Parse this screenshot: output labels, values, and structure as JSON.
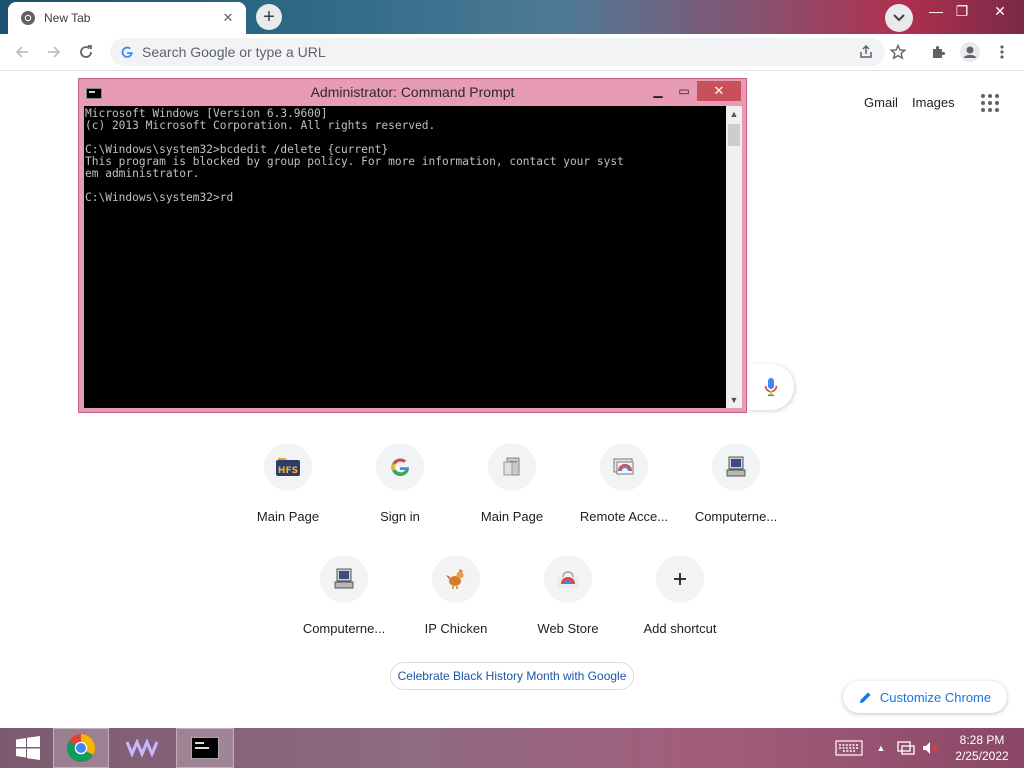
{
  "browser": {
    "tab_title": "New Tab",
    "omnibox_placeholder": "Search Google or type a URL"
  },
  "header_links": {
    "gmail": "Gmail",
    "images": "Images"
  },
  "cmd": {
    "title": "Administrator: Command Prompt",
    "lines": [
      "Microsoft Windows [Version 6.3.9600]",
      "(c) 2013 Microsoft Corporation. All rights reserved.",
      "",
      "C:\\Windows\\system32>bcdedit /delete {current}",
      "This program is blocked by group policy. For more information, contact your syst",
      "em administrator.",
      "",
      "C:\\Windows\\system32>rd"
    ]
  },
  "shortcuts": [
    {
      "label": "Main Page",
      "icon": "hfs-icon"
    },
    {
      "label": "Sign in",
      "icon": "google-icon"
    },
    {
      "label": "Main Page",
      "icon": "server-icon"
    },
    {
      "label": "Remote Acce...",
      "icon": "remote-access-icon"
    },
    {
      "label": "Computerne...",
      "icon": "computer-icon"
    },
    {
      "label": "Computerne...",
      "icon": "computer-icon"
    },
    {
      "label": "IP Chicken",
      "icon": "chicken-icon"
    },
    {
      "label": "Web Store",
      "icon": "webstore-icon"
    },
    {
      "label": "Add shortcut",
      "icon": "plus-icon"
    }
  ],
  "doodle_chip": "Celebrate Black History Month with Google",
  "customize_chrome": "Customize Chrome",
  "taskbar": {
    "time": "8:28 PM",
    "date": "2/25/2022"
  },
  "colors": {
    "accent_blue": "#1a73e8",
    "cmd_frame": "#e79bb5",
    "cmd_close": "#c7505b"
  }
}
